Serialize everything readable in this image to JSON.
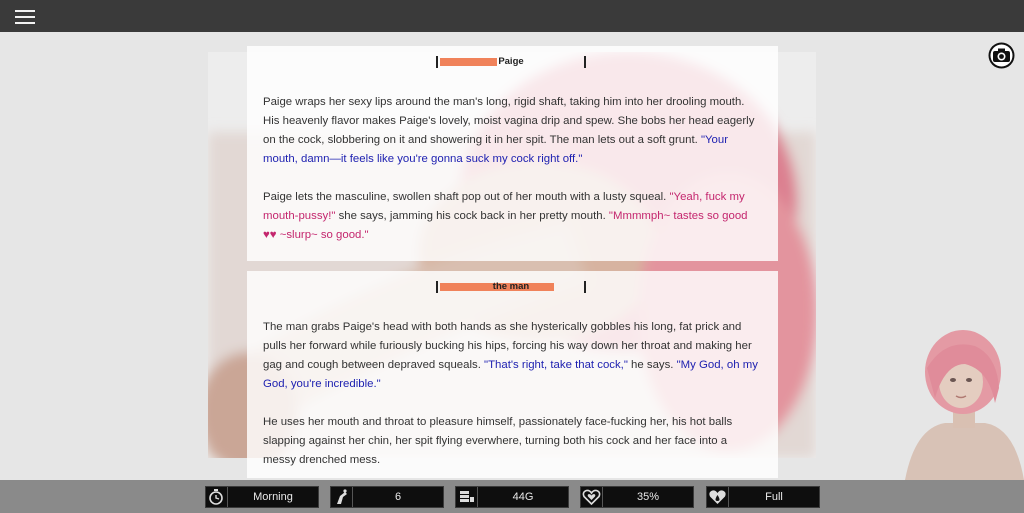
{
  "top_bar": {
    "menu_icon": "hamburger-menu-icon"
  },
  "camera_icon": "camera-icon",
  "colors": {
    "top_bar": "#3a3a3a",
    "speaker_bar_fill": "#f0825a",
    "dialogue_blue": "#1c1fb0",
    "dialogue_pink": "#c4266e",
    "status_bar": "#8a8a8a",
    "stat_box": "#0e0e0e"
  },
  "cards": [
    {
      "speaker": "Paige",
      "speaker_bar_level": 0.4,
      "paragraphs": [
        [
          {
            "style": "plain",
            "text": "Paige wraps her sexy lips around the man's long, rigid shaft, taking him into her drooling mouth. His heavenly flavor makes Paige's lovely, moist vagina drip and spew. She bobs her head eagerly on the cock, slobbering on it and showering it in her spit. The man lets out a soft grunt. "
          },
          {
            "style": "blue",
            "text": "\"Your mouth, damn—it feels like you're gonna suck my cock right off.\""
          }
        ],
        [
          {
            "style": "plain",
            "text": "Paige lets the masculine, swollen shaft pop out of her mouth with a lusty squeal. "
          },
          {
            "style": "pink",
            "text": "\"Yeah, fuck my mouth-pussy!\""
          },
          {
            "style": "plain",
            "text": " she says, jamming his cock back in her pretty mouth. "
          },
          {
            "style": "pink",
            "text": "\"Mmmmph~ tastes so good ♥♥ ~slurp~ so good.\""
          }
        ]
      ]
    },
    {
      "speaker": "the man",
      "speaker_bar_level": 0.8,
      "paragraphs": [
        [
          {
            "style": "plain",
            "text": "The man grabs Paige's head with both hands as she hysterically gobbles his long, fat prick and pulls her forward while furiously bucking his hips, forcing his way down her throat and making her gag and cough between depraved squeals. "
          },
          {
            "style": "blue",
            "text": "\"That's right, take that cock,\""
          },
          {
            "style": "plain",
            "text": " he says. "
          },
          {
            "style": "blue",
            "text": "\"My God, oh my God, you're incredible.\""
          }
        ],
        [
          {
            "style": "plain",
            "text": "He uses her mouth and throat to pleasure himself, passionately face-fucking her, his hot balls slapping against her chin, her spit flying everwhere, turning both his cock and her face into a messy drenched mess."
          }
        ]
      ]
    }
  ],
  "status_bar": {
    "items": [
      {
        "icon": "clock-icon",
        "value": "Morning"
      },
      {
        "icon": "footprint-icon",
        "value": "6"
      },
      {
        "icon": "coins-icon",
        "value": "44G"
      },
      {
        "icon": "heart-icon",
        "value": "35%"
      },
      {
        "icon": "droplet-heart-icon",
        "value": "Full"
      }
    ]
  }
}
